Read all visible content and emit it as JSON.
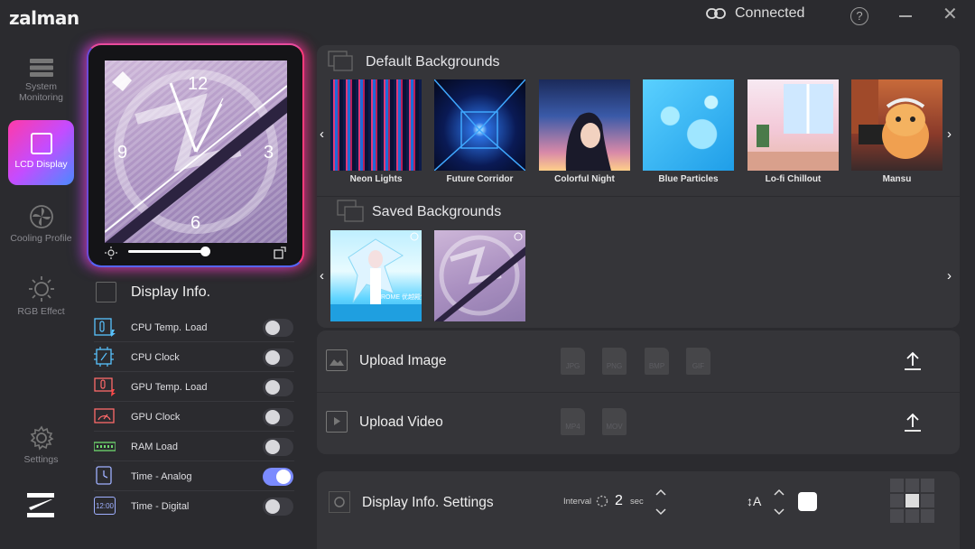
{
  "app": {
    "brand": "zalman",
    "connection": "Connected",
    "help": "?"
  },
  "sidebar": [
    {
      "label": "System Monitoring",
      "icon": "system-monitoring-icon"
    },
    {
      "label": "LCD Display",
      "icon": "lcd-display-icon",
      "active": true
    },
    {
      "label": "Cooling Profile",
      "icon": "cooling-fan-icon"
    },
    {
      "label": "RGB Effect",
      "icon": "rgb-sun-icon"
    },
    {
      "label": "Settings",
      "icon": "gear-icon"
    }
  ],
  "preview": {
    "clock_numbers": [
      "12",
      "9",
      "3",
      "6"
    ],
    "brightness": 0.85
  },
  "display_info": {
    "title": "Display Info.",
    "items": [
      {
        "label": "CPU Temp.",
        "extra": "Load",
        "on": false
      },
      {
        "label": "CPU Clock",
        "extra": "",
        "on": false
      },
      {
        "label": "GPU Temp.",
        "extra": "Load",
        "on": false
      },
      {
        "label": "GPU Clock",
        "extra": "",
        "on": false
      },
      {
        "label": "RAM Load",
        "extra": "",
        "on": false
      },
      {
        "label": "Time - Analog",
        "extra": "",
        "on": true
      },
      {
        "label": "Time - Digital",
        "extra": "",
        "on": false,
        "icon_text": "12:00"
      }
    ]
  },
  "default_backgrounds": {
    "title": "Default Backgrounds",
    "items": [
      "Neon Lights",
      "Future Corridor",
      "Colorful Night",
      "Blue Particles",
      "Lo-fi Chillout",
      "Mansu"
    ]
  },
  "saved_backgrounds": {
    "title": "Saved Backgrounds",
    "thumb_caption": "ROME 优越殿堂"
  },
  "upload_image": {
    "label": "Upload Image",
    "formats": [
      "JPG",
      "PNG",
      "BMP",
      "GIF"
    ]
  },
  "upload_video": {
    "label": "Upload Video",
    "formats": [
      "MP4",
      "MOV"
    ]
  },
  "settings": {
    "title": "Display Info. Settings",
    "interval_label": "Interval",
    "interval_value": "2",
    "interval_unit": "sec",
    "font_size_icon": "↕A"
  },
  "colors": {
    "accent": "#7b8bff",
    "lcd_active_gradient": [
      "#ff3aa8",
      "#c44cff",
      "#4a8cff"
    ],
    "panel": "#353539",
    "background": "#2b2b2f"
  }
}
